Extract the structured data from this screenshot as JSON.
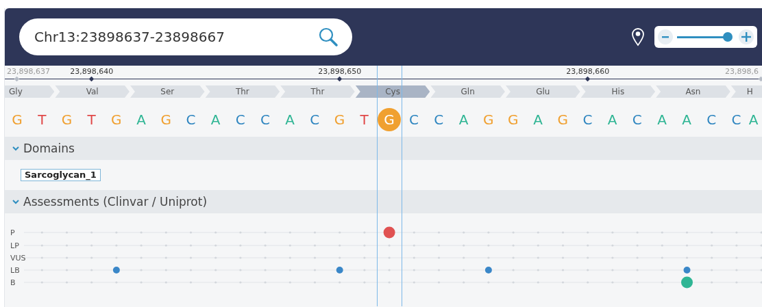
{
  "search": {
    "value": "Chr13:23898637-23898667"
  },
  "zoom": {
    "level": 0.88
  },
  "amino_acids": [
    {
      "label": "Gly",
      "selected": false
    },
    {
      "label": "Val",
      "selected": false
    },
    {
      "label": "Ser",
      "selected": false
    },
    {
      "label": "Thr",
      "selected": false
    },
    {
      "label": "Thr",
      "selected": false
    },
    {
      "label": "Cys",
      "selected": true
    },
    {
      "label": "Gln",
      "selected": false
    },
    {
      "label": "Glu",
      "selected": false
    },
    {
      "label": "His",
      "selected": false
    },
    {
      "label": "Asn",
      "selected": false
    },
    {
      "label": "H",
      "selected": false
    }
  ],
  "bases": [
    {
      "letter": "G",
      "color": "#f0a030",
      "selected": false,
      "position": {
        "label": "23,898,637",
        "active": false
      }
    },
    {
      "letter": "T",
      "color": "#e04848",
      "selected": false
    },
    {
      "letter": "G",
      "color": "#f0a030",
      "selected": false
    },
    {
      "letter": "T",
      "color": "#e04848",
      "selected": false,
      "position": {
        "label": "23,898,640",
        "active": true
      }
    },
    {
      "letter": "G",
      "color": "#f0a030",
      "selected": false
    },
    {
      "letter": "A",
      "color": "#2fb594",
      "selected": false
    },
    {
      "letter": "G",
      "color": "#f0a030",
      "selected": false
    },
    {
      "letter": "C",
      "color": "#2f86c0",
      "selected": false
    },
    {
      "letter": "A",
      "color": "#2fb594",
      "selected": false
    },
    {
      "letter": "C",
      "color": "#2f86c0",
      "selected": false
    },
    {
      "letter": "C",
      "color": "#2f86c0",
      "selected": false
    },
    {
      "letter": "A",
      "color": "#2fb594",
      "selected": false
    },
    {
      "letter": "C",
      "color": "#2f86c0",
      "selected": false
    },
    {
      "letter": "G",
      "color": "#f0a030",
      "selected": false,
      "position": {
        "label": "23,898,650",
        "active": true
      }
    },
    {
      "letter": "T",
      "color": "#e04848",
      "selected": false
    },
    {
      "letter": "G",
      "color": "#f0a030",
      "selected": true
    },
    {
      "letter": "C",
      "color": "#2f86c0",
      "selected": false
    },
    {
      "letter": "C",
      "color": "#2f86c0",
      "selected": false
    },
    {
      "letter": "A",
      "color": "#2fb594",
      "selected": false
    },
    {
      "letter": "G",
      "color": "#f0a030",
      "selected": false
    },
    {
      "letter": "G",
      "color": "#f0a030",
      "selected": false
    },
    {
      "letter": "A",
      "color": "#2fb594",
      "selected": false
    },
    {
      "letter": "G",
      "color": "#f0a030",
      "selected": false
    },
    {
      "letter": "C",
      "color": "#2f86c0",
      "selected": false,
      "position": {
        "label": "23,898,660",
        "active": true
      }
    },
    {
      "letter": "A",
      "color": "#2fb594",
      "selected": false
    },
    {
      "letter": "C",
      "color": "#2f86c0",
      "selected": false
    },
    {
      "letter": "A",
      "color": "#2fb594",
      "selected": false
    },
    {
      "letter": "A",
      "color": "#2fb594",
      "selected": false
    },
    {
      "letter": "C",
      "color": "#2f86c0",
      "selected": false
    },
    {
      "letter": "C",
      "color": "#2f86c0",
      "selected": false
    },
    {
      "letter": "A",
      "color": "#2fb594",
      "selected": false,
      "position": {
        "label": "23,898,6",
        "active": false
      }
    }
  ],
  "domains": {
    "title": "Domains",
    "expanded": true,
    "items": [
      "Sarcoglycan_1"
    ]
  },
  "assessments": {
    "title": "Assessments (Clinvar / Uniprot)",
    "expanded": true,
    "rows": [
      {
        "label": "P",
        "cells": [
          {
            "kind": "grid"
          },
          {
            "kind": "grid"
          },
          {
            "kind": "grid"
          },
          {
            "kind": "grid"
          },
          {
            "kind": "grid"
          },
          {
            "kind": "grid"
          },
          {
            "kind": "grid"
          },
          {
            "kind": "grid"
          },
          {
            "kind": "grid"
          },
          {
            "kind": "grid"
          },
          {
            "kind": "grid"
          },
          {
            "kind": "grid"
          },
          {
            "kind": "grid"
          },
          {
            "kind": "grid"
          },
          {
            "kind": "grid"
          },
          {
            "kind": "large",
            "color": "#e05252"
          },
          {
            "kind": "grid"
          },
          {
            "kind": "grid"
          },
          {
            "kind": "grid"
          },
          {
            "kind": "grid"
          },
          {
            "kind": "grid"
          },
          {
            "kind": "grid"
          },
          {
            "kind": "grid"
          },
          {
            "kind": "grid"
          },
          {
            "kind": "grid"
          },
          {
            "kind": "grid"
          },
          {
            "kind": "grid"
          },
          {
            "kind": "grid"
          },
          {
            "kind": "grid"
          },
          {
            "kind": "grid"
          },
          {
            "kind": "grid"
          }
        ]
      },
      {
        "label": "LP",
        "cells": [
          {
            "kind": "grid"
          },
          {
            "kind": "grid"
          },
          {
            "kind": "grid"
          },
          {
            "kind": "grid"
          },
          {
            "kind": "grid"
          },
          {
            "kind": "grid"
          },
          {
            "kind": "grid"
          },
          {
            "kind": "grid"
          },
          {
            "kind": "grid"
          },
          {
            "kind": "grid"
          },
          {
            "kind": "grid"
          },
          {
            "kind": "grid"
          },
          {
            "kind": "grid"
          },
          {
            "kind": "grid"
          },
          {
            "kind": "grid"
          },
          {
            "kind": "grid"
          },
          {
            "kind": "grid"
          },
          {
            "kind": "grid"
          },
          {
            "kind": "grid"
          },
          {
            "kind": "grid"
          },
          {
            "kind": "grid"
          },
          {
            "kind": "grid"
          },
          {
            "kind": "grid"
          },
          {
            "kind": "grid"
          },
          {
            "kind": "grid"
          },
          {
            "kind": "grid"
          },
          {
            "kind": "grid"
          },
          {
            "kind": "grid"
          },
          {
            "kind": "grid"
          },
          {
            "kind": "grid"
          },
          {
            "kind": "grid"
          }
        ]
      },
      {
        "label": "VUS",
        "cells": [
          {
            "kind": "grid"
          },
          {
            "kind": "grid"
          },
          {
            "kind": "grid"
          },
          {
            "kind": "grid"
          },
          {
            "kind": "grid"
          },
          {
            "kind": "grid"
          },
          {
            "kind": "grid"
          },
          {
            "kind": "grid"
          },
          {
            "kind": "grid"
          },
          {
            "kind": "grid"
          },
          {
            "kind": "grid"
          },
          {
            "kind": "grid"
          },
          {
            "kind": "grid"
          },
          {
            "kind": "grid"
          },
          {
            "kind": "grid"
          },
          {
            "kind": "grid"
          },
          {
            "kind": "grid"
          },
          {
            "kind": "grid"
          },
          {
            "kind": "grid"
          },
          {
            "kind": "grid"
          },
          {
            "kind": "grid"
          },
          {
            "kind": "grid"
          },
          {
            "kind": "grid"
          },
          {
            "kind": "grid"
          },
          {
            "kind": "grid"
          },
          {
            "kind": "grid"
          },
          {
            "kind": "grid"
          },
          {
            "kind": "grid"
          },
          {
            "kind": "grid"
          },
          {
            "kind": "grid"
          },
          {
            "kind": "grid"
          }
        ]
      },
      {
        "label": "LB",
        "cells": [
          {
            "kind": "grid"
          },
          {
            "kind": "grid"
          },
          {
            "kind": "grid"
          },
          {
            "kind": "grid"
          },
          {
            "kind": "small",
            "color": "#3a87c8"
          },
          {
            "kind": "grid"
          },
          {
            "kind": "grid"
          },
          {
            "kind": "grid"
          },
          {
            "kind": "grid"
          },
          {
            "kind": "grid"
          },
          {
            "kind": "grid"
          },
          {
            "kind": "grid"
          },
          {
            "kind": "grid"
          },
          {
            "kind": "small",
            "color": "#3a87c8"
          },
          {
            "kind": "grid"
          },
          {
            "kind": "grid"
          },
          {
            "kind": "grid"
          },
          {
            "kind": "grid"
          },
          {
            "kind": "grid"
          },
          {
            "kind": "small",
            "color": "#3a87c8"
          },
          {
            "kind": "grid"
          },
          {
            "kind": "grid"
          },
          {
            "kind": "grid"
          },
          {
            "kind": "grid"
          },
          {
            "kind": "grid"
          },
          {
            "kind": "grid"
          },
          {
            "kind": "grid"
          },
          {
            "kind": "small",
            "color": "#3a87c8"
          },
          {
            "kind": "grid"
          },
          {
            "kind": "grid"
          },
          {
            "kind": "grid"
          }
        ]
      },
      {
        "label": "B",
        "cells": [
          {
            "kind": "grid"
          },
          {
            "kind": "grid"
          },
          {
            "kind": "grid"
          },
          {
            "kind": "grid"
          },
          {
            "kind": "grid"
          },
          {
            "kind": "grid"
          },
          {
            "kind": "grid"
          },
          {
            "kind": "grid"
          },
          {
            "kind": "grid"
          },
          {
            "kind": "grid"
          },
          {
            "kind": "grid"
          },
          {
            "kind": "grid"
          },
          {
            "kind": "grid"
          },
          {
            "kind": "grid"
          },
          {
            "kind": "grid"
          },
          {
            "kind": "grid"
          },
          {
            "kind": "grid"
          },
          {
            "kind": "grid"
          },
          {
            "kind": "grid"
          },
          {
            "kind": "grid"
          },
          {
            "kind": "grid"
          },
          {
            "kind": "grid"
          },
          {
            "kind": "grid"
          },
          {
            "kind": "grid"
          },
          {
            "kind": "grid"
          },
          {
            "kind": "grid"
          },
          {
            "kind": "grid"
          },
          {
            "kind": "large",
            "color": "#2fb594"
          },
          {
            "kind": "grid"
          },
          {
            "kind": "grid"
          },
          {
            "kind": "grid"
          }
        ]
      }
    ]
  }
}
